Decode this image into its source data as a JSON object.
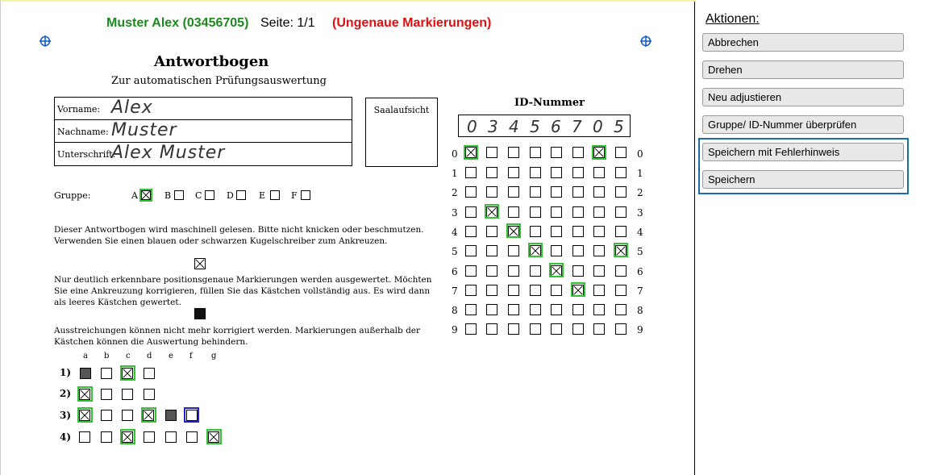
{
  "header": {
    "student": "Muster Alex (03456705)",
    "page": "Seite: 1/1",
    "warning": "(Ungenaue Markierungen)"
  },
  "sheet": {
    "title": "Antwortbogen",
    "subtitle": "Zur automatischen Prüfungsauswertung",
    "fields": [
      {
        "label": "Vorname:",
        "value": "Alex"
      },
      {
        "label": "Nachname:",
        "value": "Muster"
      },
      {
        "label": "Unterschrift:",
        "value": "Alex Muster"
      }
    ],
    "saal": "Saalaufsicht",
    "gruppe_label": "Gruppe:",
    "gruppe_options": [
      "A",
      "B",
      "C",
      "D",
      "E",
      "F"
    ],
    "gruppe_selected": "A",
    "para1": "Dieser Antwortbogen wird maschinell gelesen. Bitte nicht knicken oder beschmutzen. Verwenden Sie einen blauen oder schwarzen Kugelschreiber zum Ankreuzen.",
    "para2": "Nur deutlich erkennbare positionsgenaue Markierungen werden ausgewertet. Möchten Sie eine Ankreuzung korrigieren, füllen Sie das Kästchen vollständig aus. Es wird dann als leeres Kästchen gewertet.",
    "para3": "Ausstreichungen können nicht mehr korrigiert werden. Markierungen außerhalb der Kästchen können die Auswertung behindern.",
    "id_title": "ID-Nummer",
    "id_digits": [
      "0",
      "3",
      "4",
      "5",
      "6",
      "7",
      "0",
      "5"
    ],
    "answer_columns": [
      "a",
      "b",
      "c",
      "d",
      "e",
      "f",
      "g"
    ],
    "questions": [
      "1)",
      "2)",
      "3)",
      "4)"
    ]
  },
  "actions": {
    "title": "Aktionen:",
    "buttons": [
      "Abbrechen",
      "Drehen",
      "Neu adjustieren",
      "Gruppe/ ID-Nummer überprüfen",
      "Speichern mit Fehlerhinweis",
      "Speichern"
    ]
  },
  "colors": {
    "name": "#1d8a1d",
    "warning": "#e01010",
    "highlight": "#2ec52e",
    "save_group_border": "#1a6bb0"
  }
}
